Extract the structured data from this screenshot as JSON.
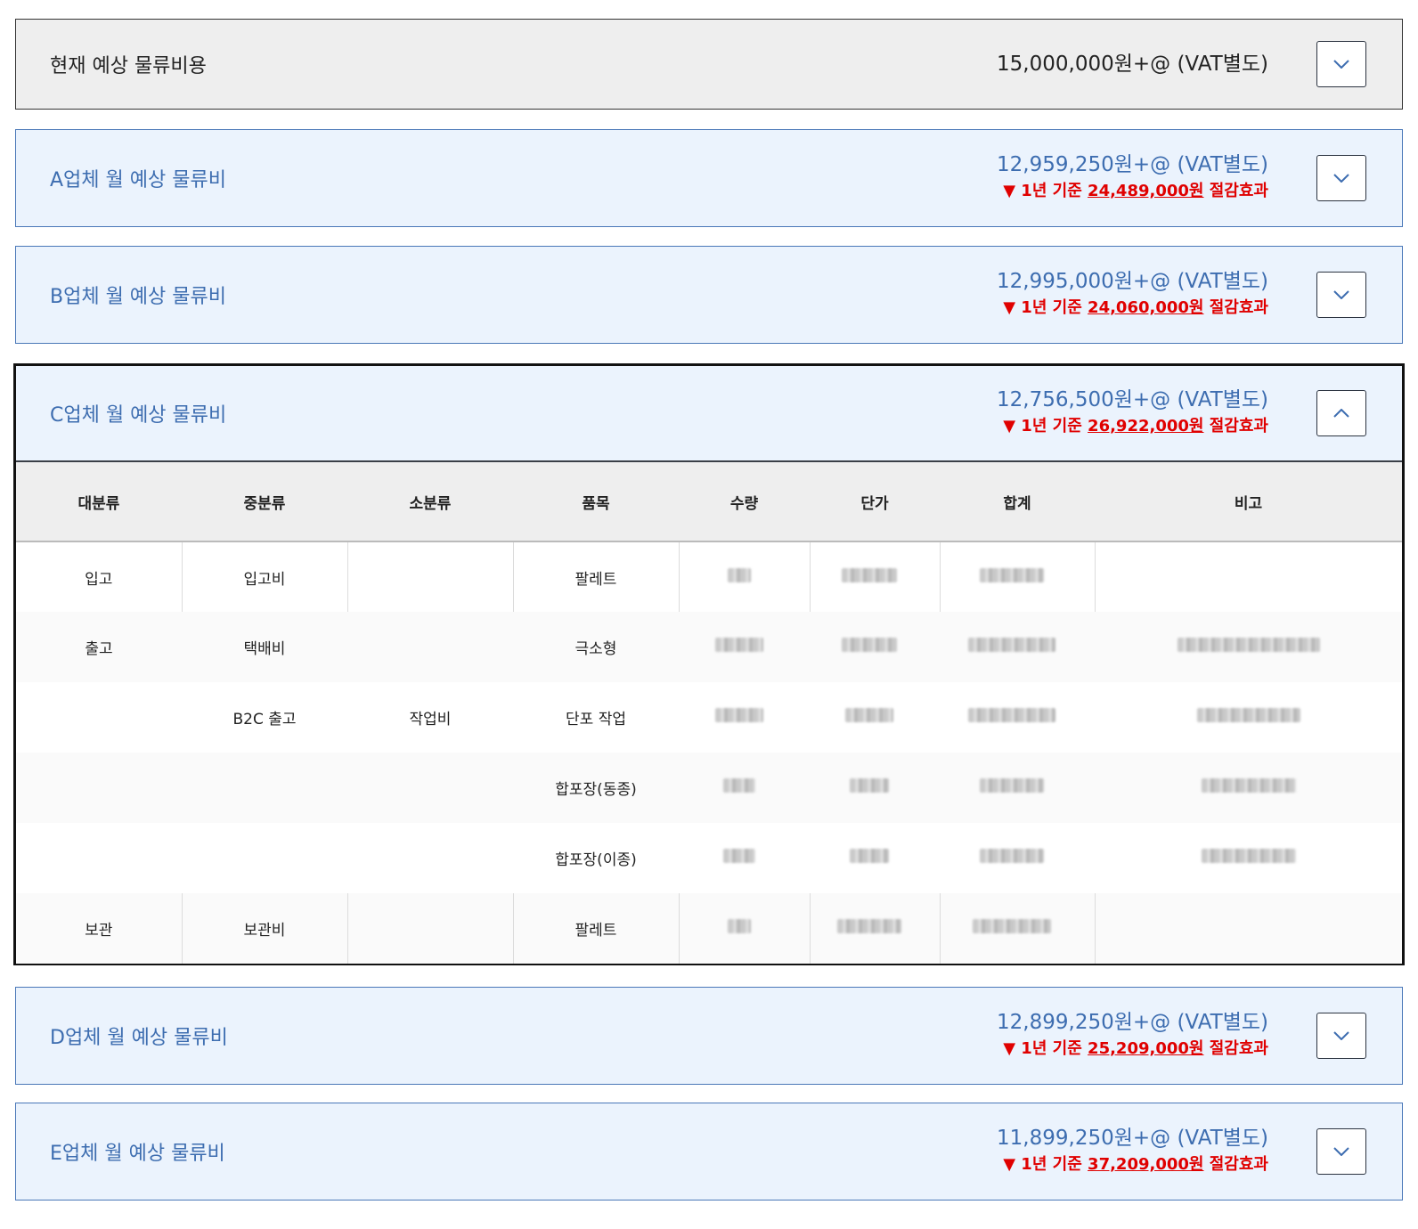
{
  "current": {
    "title": "현재 예상 물류비용",
    "price": "15,000,000원+@ (VAT별도)"
  },
  "vendors": {
    "a": {
      "title": "A업체 월 예상 물류비",
      "price": "12,959,250원+@ (VAT별도)",
      "saving_prefix": "▼ 1년 기준 ",
      "saving_amount": "24,489,000원",
      "saving_suffix": " 절감효과"
    },
    "b": {
      "title": "B업체 월 예상 물류비",
      "price": "12,995,000원+@ (VAT별도)",
      "saving_prefix": "▼ 1년 기준 ",
      "saving_amount": "24,060,000원",
      "saving_suffix": " 절감효과"
    },
    "c": {
      "title": "C업체 월 예상 물류비",
      "price": "12,756,500원+@ (VAT별도)",
      "saving_prefix": "▼ 1년 기준 ",
      "saving_amount": "26,922,000원",
      "saving_suffix": " 절감효과"
    },
    "d": {
      "title": "D업체 월 예상 물류비",
      "price": "12,899,250원+@ (VAT별도)",
      "saving_prefix": "▼ 1년 기준 ",
      "saving_amount": "25,209,000원",
      "saving_suffix": " 절감효과"
    },
    "e": {
      "title": "E업체 월 예상 물류비",
      "price": "11,899,250원+@ (VAT별도)",
      "saving_prefix": "▼ 1년 기준 ",
      "saving_amount": "37,209,000원",
      "saving_suffix": " 절감효과"
    }
  },
  "table": {
    "headers": [
      "대분류",
      "중분류",
      "소분류",
      "품목",
      "수량",
      "단가",
      "합계",
      "비고"
    ],
    "rows": [
      {
        "major": "입고",
        "middle": "입고비",
        "minor": "",
        "item": "팔레트"
      },
      {
        "major": "출고",
        "middle": "택배비",
        "minor": "",
        "item": "극소형"
      },
      {
        "major": "",
        "middle": "B2C 출고",
        "minor": "작업비",
        "item": "단포 작업"
      },
      {
        "major": "",
        "middle": "",
        "minor": "",
        "item": "합포장(동종)"
      },
      {
        "major": "",
        "middle": "",
        "minor": "",
        "item": "합포장(이종)"
      },
      {
        "major": "보관",
        "middle": "보관비",
        "minor": "",
        "item": "팔레트"
      }
    ]
  },
  "colors": {
    "accent": "#3d6db0",
    "panel_bg": "#ebf3fd",
    "saving_red": "#e00000"
  },
  "icons": {
    "collapsed": "chevron-down-icon",
    "expanded": "chevron-up-icon"
  }
}
